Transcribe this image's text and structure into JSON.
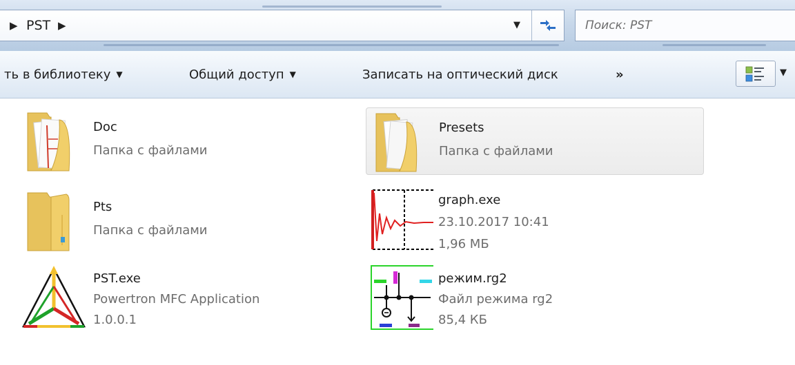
{
  "address_bar": {
    "breadcrumb": [
      "PST"
    ],
    "search_placeholder": "Поиск: PST"
  },
  "command_bar": {
    "items": [
      {
        "label": "ть в библиотеку",
        "has_dropdown": true
      },
      {
        "label": "Общий доступ",
        "has_dropdown": true
      },
      {
        "label": "Записать на оптический диск",
        "has_dropdown": false
      }
    ],
    "more_label": "»",
    "view_icon": "change-view-icon"
  },
  "files": [
    {
      "name": "Doc",
      "type": "Папка с файлами",
      "icon": "folder-icon"
    },
    {
      "name": "Presets",
      "type": "Папка с файлами",
      "icon": "folder-icon",
      "selected": true
    },
    {
      "name": "Pts",
      "type": "Папка с файлами",
      "icon": "folder-icon"
    },
    {
      "name": "graph.exe",
      "type": "23.10.2017 10:41",
      "size": "1,96 МБ",
      "icon": "graph-app-icon"
    },
    {
      "name": "PST.exe",
      "type": "Powertron MFC Application",
      "size": "1.0.0.1",
      "icon": "triangle-app-icon"
    },
    {
      "name": "режим.rg2",
      "type": "Файл режима rg2",
      "size": "85,4 КБ",
      "icon": "circuit-file-icon"
    }
  ],
  "colors": {
    "accent_selected_bg": "#ececec",
    "text_secondary": "#6d6d6d",
    "toolbar_gradient_top": "#f7fafd"
  }
}
